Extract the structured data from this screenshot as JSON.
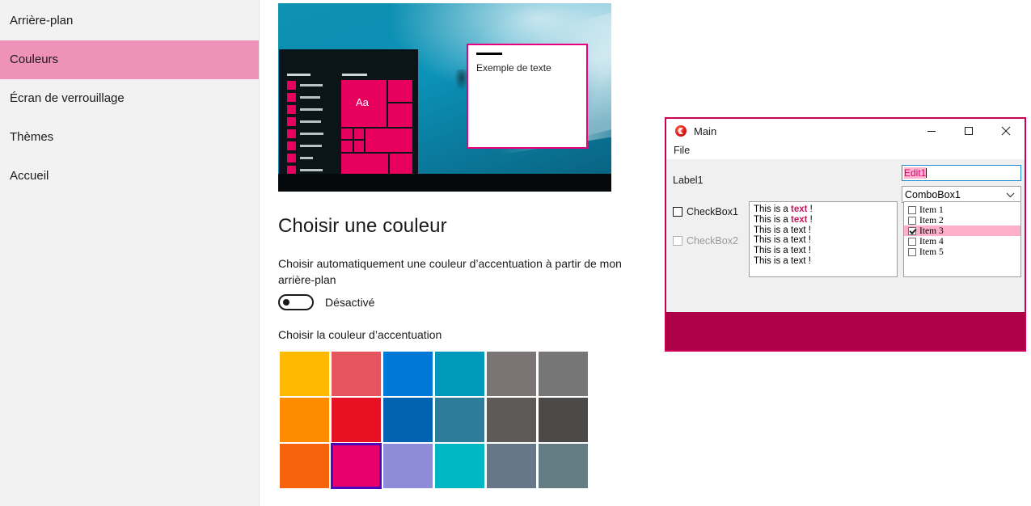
{
  "sidebar": {
    "items": [
      {
        "label": "Arrière-plan",
        "selected": false
      },
      {
        "label": "Couleurs",
        "selected": true
      },
      {
        "label": "Écran de verrouillage",
        "selected": false
      },
      {
        "label": "Thèmes",
        "selected": false
      },
      {
        "label": "Accueil",
        "selected": false
      }
    ],
    "selected_bg": "#ee92b9"
  },
  "preview": {
    "sample_card_text": "Exemple de texte",
    "start_menu_tile_letters": "Aa",
    "accent_color": "#e8005e",
    "card_border_color": "#e8007d",
    "wallpaper_description": "underwater-ocean-photo"
  },
  "settings": {
    "title": "Choisir une couleur",
    "auto_accent_label": "Choisir automatiquement une couleur d’accentuation à partir de mon arrière-plan",
    "toggle_state": "Désactivé",
    "accent_section_label": "Choisir la couleur d’accentuation",
    "swatches": [
      {
        "color": "#ffb900",
        "selected": false
      },
      {
        "color": "#e4555e",
        "selected": false
      },
      {
        "color": "#0078d7",
        "selected": false
      },
      {
        "color": "#0099bc",
        "selected": false
      },
      {
        "color": "#7a7574",
        "selected": false
      },
      {
        "color": "#767676",
        "selected": false
      },
      {
        "color": "#ff8c00",
        "selected": false
      },
      {
        "color": "#e81123",
        "selected": false
      },
      {
        "color": "#0063b1",
        "selected": false
      },
      {
        "color": "#2d7d9a",
        "selected": false
      },
      {
        "color": "#5d5a58",
        "selected": false
      },
      {
        "color": "#4c4a48",
        "selected": false
      },
      {
        "color": "#f7630c",
        "selected": false
      },
      {
        "color": "#e8006b",
        "selected": true
      },
      {
        "color": "#8e8cd8",
        "selected": false
      },
      {
        "color": "#00b7c3",
        "selected": false
      },
      {
        "color": "#68768a",
        "selected": false
      },
      {
        "color": "#647c84",
        "selected": false
      }
    ],
    "selection_outline_color": "#4b0bbd"
  },
  "main_window": {
    "title": "Main",
    "icon": "lazarus-app-icon",
    "border_color": "#cc0052",
    "window_buttons": {
      "minimize": "—",
      "maximize": "□",
      "close": "✕"
    },
    "menu": [
      "File"
    ],
    "label1": "Label1",
    "edit1": {
      "value": "Edit1",
      "selected": true,
      "selection_bg": "#ffb3cc",
      "selection_fg": "#d6007a"
    },
    "combobox1": {
      "value": "ComboBox1"
    },
    "checkbox1": {
      "label": "CheckBox1",
      "checked": false,
      "enabled": true
    },
    "checkbox2": {
      "label": "CheckBox2",
      "checked": false,
      "enabled": false
    },
    "memo1": {
      "lines": [
        {
          "pre": "This is a ",
          "emph": "text",
          "post": " !",
          "bold": true
        },
        {
          "pre": "This is a ",
          "emph": "text",
          "post": " !",
          "bold": true
        },
        {
          "pre": "This is a ",
          "emph": "text",
          "post": " !",
          "bold": false
        },
        {
          "pre": "This is a ",
          "emph": "text",
          "post": " !",
          "bold": false
        },
        {
          "pre": "This is a ",
          "emph": "text",
          "post": " !",
          "bold": false
        },
        {
          "pre": "This is a ",
          "emph": "text",
          "post": " !",
          "bold": false
        }
      ],
      "emphasis_color": "#c2185b"
    },
    "listbox1": {
      "items": [
        {
          "label": "Item 1",
          "checked": false,
          "selected": false
        },
        {
          "label": "Item 2",
          "checked": false,
          "selected": false
        },
        {
          "label": "Item 3",
          "checked": true,
          "selected": true
        },
        {
          "label": "Item 4",
          "checked": false,
          "selected": false
        },
        {
          "label": "Item 5",
          "checked": false,
          "selected": false
        }
      ],
      "selection_bg": "#ffafc9"
    },
    "statusbar_color": "#ad0047"
  }
}
